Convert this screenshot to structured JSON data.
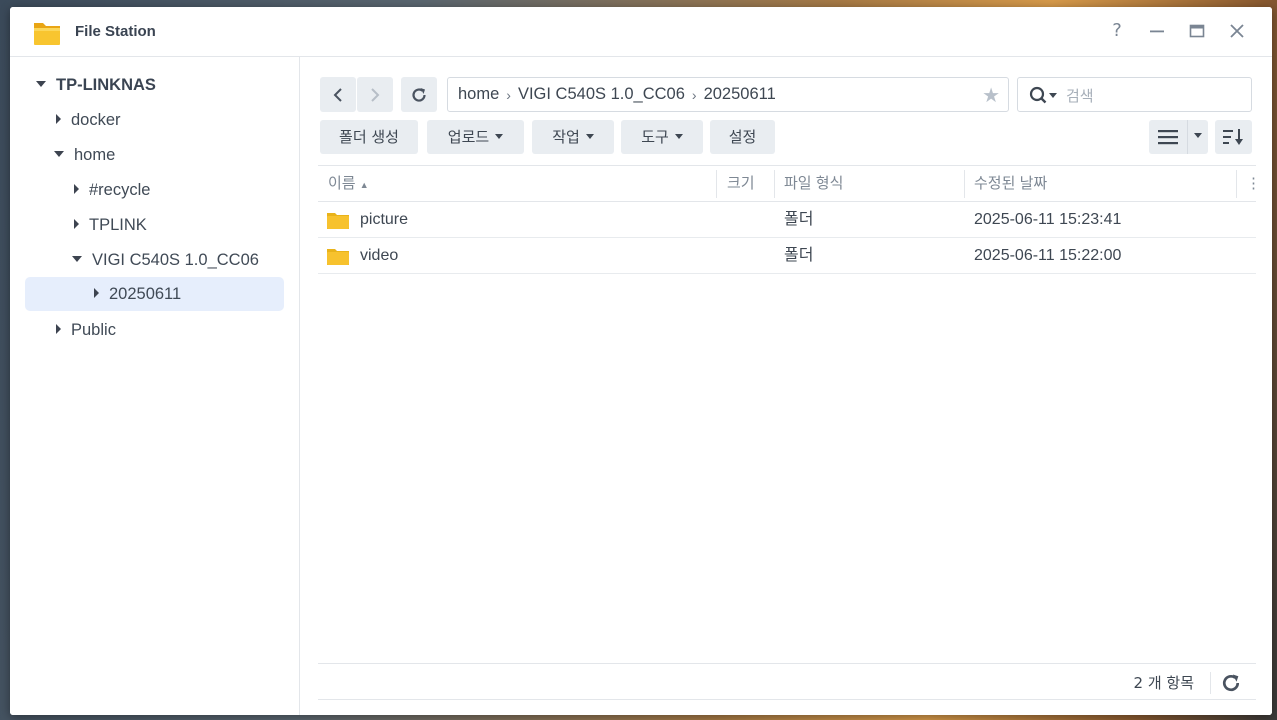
{
  "window": {
    "title": "File Station"
  },
  "sidebar": {
    "root": "TP-LINKNAS",
    "items": [
      {
        "label": "docker"
      },
      {
        "label": "home"
      },
      {
        "label": "#recycle"
      },
      {
        "label": "TPLINK"
      },
      {
        "label": "VIGI C540S 1.0_CC06"
      },
      {
        "label": "20250611"
      },
      {
        "label": "Public"
      }
    ]
  },
  "path": {
    "crumbs": [
      "home",
      "VIGI C540S 1.0_CC06",
      "20250611"
    ]
  },
  "search": {
    "placeholder": "검색"
  },
  "toolbar": {
    "create_folder": "폴더 생성",
    "upload": "업로드",
    "action": "작업",
    "tools": "도구",
    "settings": "설정"
  },
  "table": {
    "columns": {
      "name": "이름",
      "size": "크기",
      "type": "파일 형식",
      "modified": "수정된 날짜"
    },
    "rows": [
      {
        "name": "picture",
        "size": "",
        "type": "폴더",
        "modified": "2025-06-11 15:23:41"
      },
      {
        "name": "video",
        "size": "",
        "type": "폴더",
        "modified": "2025-06-11 15:22:00"
      }
    ]
  },
  "footer": {
    "count_label": "2 개 항목"
  },
  "colors": {
    "accent": "#e6eefc",
    "folder": "#f7c22e"
  }
}
